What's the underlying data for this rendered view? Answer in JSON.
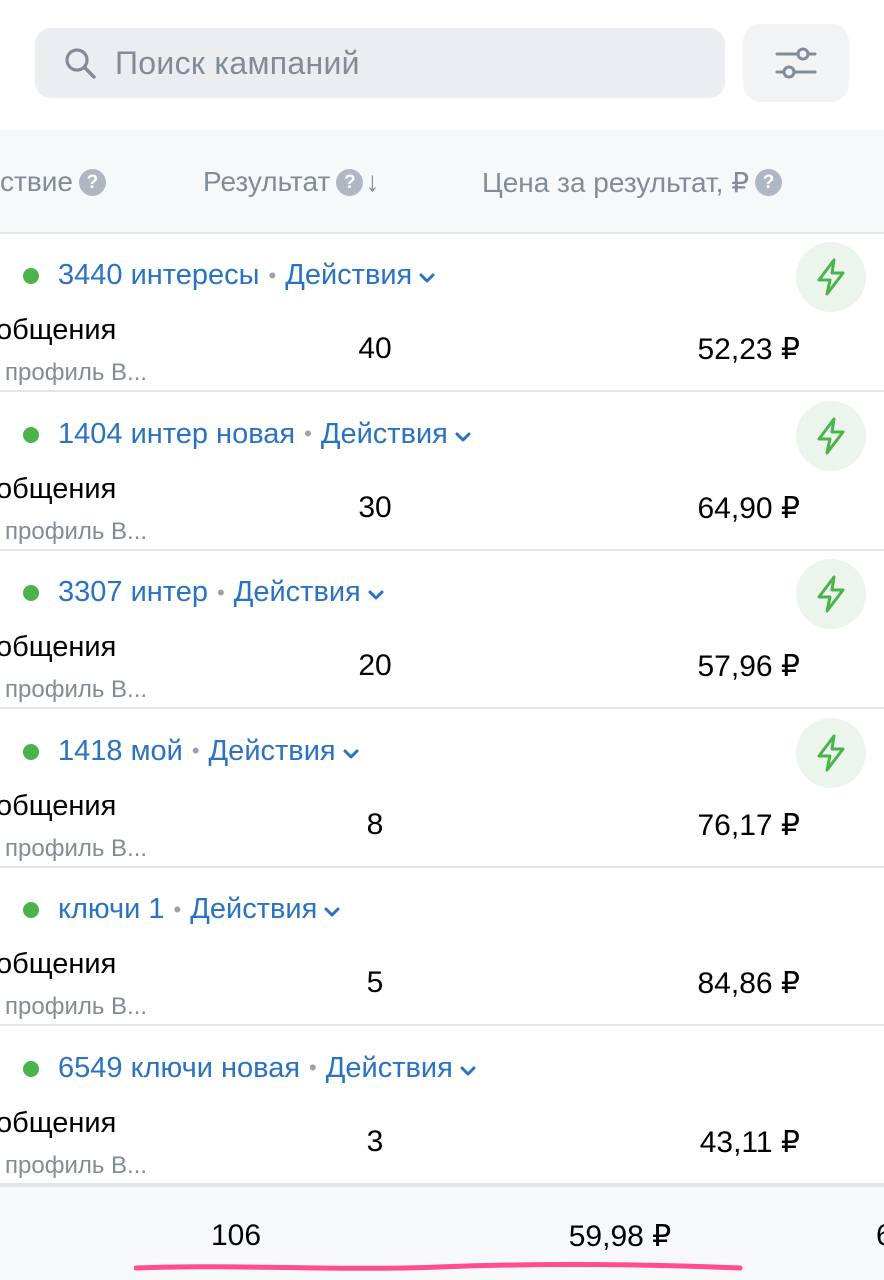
{
  "search": {
    "placeholder": "Поиск кампаний",
    "icon": "search-icon"
  },
  "filter": {
    "icon": "sliders-icon"
  },
  "table": {
    "columns": [
      {
        "label": "ствие",
        "help_icon": "help-icon"
      },
      {
        "label": "Результат",
        "help_icon": "help-icon",
        "sort": "↓"
      },
      {
        "label": "Цена за результат, ₽",
        "help_icon": "help-icon"
      }
    ],
    "action_label": "Действия",
    "status_color": "#4bb34b",
    "link_color": "#2a72c2",
    "rows": [
      {
        "name": "3440 интересы",
        "objective": "общения",
        "placement": "профиль В...",
        "result": "40",
        "price": "52,23 ₽",
        "has_bolt": true
      },
      {
        "name": "1404 интер новая",
        "objective": "общения",
        "placement": "профиль В...",
        "result": "30",
        "price": "64,90 ₽",
        "has_bolt": true
      },
      {
        "name": "3307 интер",
        "objective": "общения",
        "placement": "профиль В...",
        "result": "20",
        "price": "57,96 ₽",
        "has_bolt": true
      },
      {
        "name": "1418 мой",
        "objective": "общения",
        "placement": "профиль В...",
        "result": "8",
        "price": "76,17 ₽",
        "has_bolt": true
      },
      {
        "name": "ключи 1",
        "objective": "общения",
        "placement": "профиль В...",
        "result": "5",
        "price": "84,86 ₽",
        "has_bolt": false
      },
      {
        "name": "6549 ключи новая",
        "objective": "общения",
        "placement": "профиль В...",
        "result": "3",
        "price": "43,11 ₽",
        "has_bolt": false
      }
    ]
  },
  "footer": {
    "total_results": "106",
    "avg_price": "59,98 ₽",
    "cut_value": "6"
  }
}
